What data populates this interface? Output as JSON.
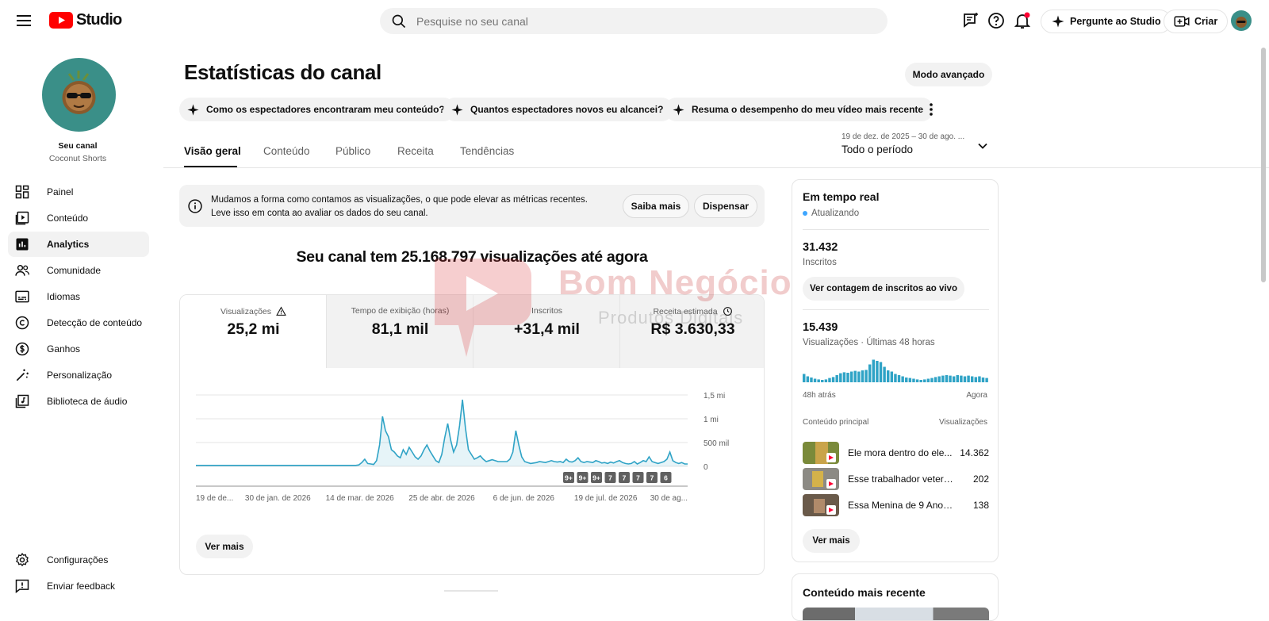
{
  "header": {
    "logo_text": "Studio",
    "search_placeholder": "Pesquise no seu canal",
    "ask_studio_label": "Pergunte ao Studio",
    "create_label": "Criar"
  },
  "sidebar": {
    "channel_title": "Seu canal",
    "channel_name": "Coconut Shorts",
    "items": [
      {
        "label": "Painel"
      },
      {
        "label": "Conteúdo"
      },
      {
        "label": "Analytics"
      },
      {
        "label": "Comunidade"
      },
      {
        "label": "Idiomas"
      },
      {
        "label": "Detecção de conteúdo"
      },
      {
        "label": "Ganhos"
      },
      {
        "label": "Personalização"
      },
      {
        "label": "Biblioteca de áudio"
      }
    ],
    "bottom_items": [
      {
        "label": "Configurações"
      },
      {
        "label": "Enviar feedback"
      }
    ]
  },
  "main": {
    "title": "Estatísticas do canal",
    "advanced_mode_label": "Modo avançado",
    "chips": [
      {
        "label": "Como os espectadores encontraram meu conteúdo?"
      },
      {
        "label": "Quantos espectadores novos eu alcancei?"
      },
      {
        "label": "Resuma o desempenho do meu vídeo mais recente"
      }
    ],
    "tabs": [
      {
        "label": "Visão geral"
      },
      {
        "label": "Conteúdo"
      },
      {
        "label": "Público"
      },
      {
        "label": "Receita"
      },
      {
        "label": "Tendências"
      }
    ],
    "date_range_sub": "19 de dez. de 2025 – 30 de ago. ...",
    "date_range_main": "Todo o período",
    "notice": {
      "line1": "Mudamos a forma como contamos as visualizações, o que pode elevar as métricas recentes.",
      "line2": "Leve isso em conta ao avaliar os dados do seu canal.",
      "learn_more": "Saiba mais",
      "dismiss": "Dispensar"
    },
    "total_text": "Seu canal tem 25.168.797 visualizações até agora",
    "metrics": [
      {
        "label": "Visualizações",
        "value": "25,2 mi"
      },
      {
        "label": "Tempo de exibição (horas)",
        "value": "81,1 mil"
      },
      {
        "label": "Inscritos",
        "value": "+31,4 mil"
      },
      {
        "label": "Receita estimada",
        "value": "R$ 3.630,33"
      }
    ],
    "see_more": "Ver mais"
  },
  "chart_data": {
    "type": "area",
    "series": [
      {
        "values": [
          0.02,
          0.02,
          0.02,
          0.02,
          0.02,
          0.02,
          0.02,
          0.02,
          0.02,
          0.02,
          0.02,
          0.02,
          0.02,
          0.02,
          0.02,
          0.02,
          0.02,
          0.02,
          0.02,
          0.02,
          0.02,
          0.02,
          0.02,
          0.02,
          0.02,
          0.02,
          0.02,
          0.02,
          0.02,
          0.02,
          0.02,
          0.02,
          0.02,
          0.02,
          0.02,
          0.02,
          0.02,
          0.02,
          0.02,
          0.02,
          0.02,
          0.02,
          0.02,
          0.02,
          0.02,
          0.02,
          0.02,
          0.02,
          0.02,
          0.02,
          0.02,
          0.02,
          0.02,
          0.02,
          0.02,
          0.03,
          0.08,
          0.15,
          0.06,
          0.05,
          0.04,
          0.12,
          0.45,
          1.05,
          0.75,
          0.62,
          0.35,
          0.3,
          0.22,
          0.18,
          0.35,
          0.25,
          0.4,
          0.3,
          0.2,
          0.15,
          0.22,
          0.35,
          0.45,
          0.32,
          0.22,
          0.12,
          0.08,
          0.25,
          0.6,
          0.9,
          0.55,
          0.3,
          0.45,
          0.85,
          1.4,
          0.8,
          0.35,
          0.25,
          0.15,
          0.18,
          0.22,
          0.15,
          0.1,
          0.12,
          0.14,
          0.12,
          0.1,
          0.1,
          0.1,
          0.1,
          0.15,
          0.3,
          0.75,
          0.45,
          0.2,
          0.1,
          0.08,
          0.06,
          0.07,
          0.08,
          0.1,
          0.09,
          0.08,
          0.1,
          0.12,
          0.1,
          0.09,
          0.1,
          0.08,
          0.15,
          0.1,
          0.09,
          0.12,
          0.18,
          0.1,
          0.08,
          0.1,
          0.09,
          0.08,
          0.12,
          0.1,
          0.07,
          0.08,
          0.06,
          0.09,
          0.07,
          0.1,
          0.12,
          0.08,
          0.06,
          0.05,
          0.06,
          0.1,
          0.05,
          0.08,
          0.12,
          0.1,
          0.2,
          0.1,
          0.08,
          0.06,
          0.08,
          0.1,
          0.15,
          0.3,
          0.12,
          0.08,
          0.06,
          0.08,
          0.05,
          0.05
        ]
      }
    ],
    "x_tick_labels": [
      "19 de de...",
      "30 de jan. de 2026",
      "14 de mar. de 2026",
      "25 de abr. de 2026",
      "6 de jun. de 2026",
      "19 de jul. de 2026",
      "30 de ag..."
    ],
    "y_tick_labels": [
      "1,5 mi",
      "1 mi",
      "500 mil",
      "0"
    ],
    "ylim": [
      0,
      1.5
    ],
    "grid": true,
    "markers": [
      "9+",
      "9+",
      "9+",
      "7",
      "7",
      "7",
      "7",
      "6"
    ]
  },
  "realtime": {
    "title": "Em tempo real",
    "status": "Atualizando",
    "subscribers_value": "31.432",
    "subscribers_label": "Inscritos",
    "live_count_button": "Ver contagem de inscritos ao vivo",
    "views_value": "15.439",
    "views_label": "Visualizações · Últimas 48 horas",
    "bars": [
      0.35,
      0.25,
      0.2,
      0.15,
      0.12,
      0.1,
      0.12,
      0.18,
      0.22,
      0.3,
      0.38,
      0.42,
      0.4,
      0.45,
      0.48,
      0.45,
      0.5,
      0.52,
      0.75,
      0.95,
      0.9,
      0.85,
      0.65,
      0.5,
      0.45,
      0.35,
      0.3,
      0.25,
      0.2,
      0.18,
      0.15,
      0.12,
      0.1,
      0.12,
      0.15,
      0.18,
      0.22,
      0.25,
      0.28,
      0.3,
      0.28,
      0.25,
      0.3,
      0.28,
      0.25,
      0.28,
      0.25,
      0.22,
      0.25,
      0.2,
      0.18
    ],
    "axis_left": "48h atrás",
    "axis_right": "Agora",
    "top_content_header": "Conteúdo principal",
    "top_content_views_header": "Visualizações",
    "top_content": [
      {
        "title": "Ele mora dentro do ele...",
        "views": "14.362"
      },
      {
        "title": "Esse trabalhador veterano...",
        "views": "202"
      },
      {
        "title": "Essa Menina de 9 Anos ...",
        "views": "138"
      }
    ],
    "see_more": "Ver mais"
  },
  "latest": {
    "title": "Conteúdo mais recente"
  },
  "watermark": {
    "line1": "Bom Negócio",
    "line2": "Produtos Digitais"
  },
  "colors": {
    "accent": "#2fa3c6",
    "youtube_red": "#ff0000",
    "avatar_bg": "#3a8f88"
  }
}
